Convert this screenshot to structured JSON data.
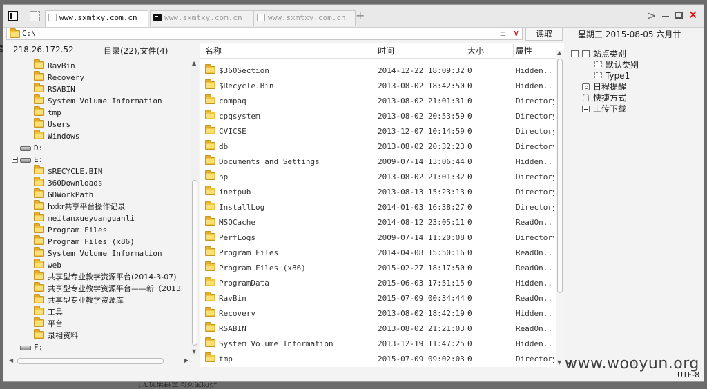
{
  "tabs": [
    {
      "label": "www.sxmtxy.com.cn",
      "icon": "page-icon",
      "active": true
    },
    {
      "label": "www.sxmtxy.com.cn",
      "icon": "terminal-icon",
      "active": false
    },
    {
      "label": "www.sxmtxy.com.cn",
      "icon": "page-icon",
      "active": false
    }
  ],
  "tabbar": {
    "new_tab": "+",
    "chevron": ">",
    "close": "✕"
  },
  "address": {
    "value": "C:\\",
    "plusminus": "±",
    "dropdown": "∨"
  },
  "toolbar": {
    "read_label": "读取",
    "date_text": "星期三  2015-08-05  六月廿一"
  },
  "left": {
    "ip": "218.26.172.52",
    "counts": "目录(22),文件(4)",
    "tree": [
      {
        "label": "RavBin",
        "type": "folder"
      },
      {
        "label": "Recovery",
        "type": "folder"
      },
      {
        "label": "RSABIN",
        "type": "folder"
      },
      {
        "label": "System Volume Information",
        "type": "folder"
      },
      {
        "label": "tmp",
        "type": "folder"
      },
      {
        "label": "Users",
        "type": "folder"
      },
      {
        "label": "Windows",
        "type": "folder"
      },
      {
        "label": "D:",
        "type": "drive"
      },
      {
        "label": "E:",
        "type": "drive"
      },
      {
        "label": "$RECYCLE.BIN",
        "type": "folder"
      },
      {
        "label": "360Downloads",
        "type": "folder"
      },
      {
        "label": "GDWorkPath",
        "type": "folder"
      },
      {
        "label": "hxkr共享平台操作记录",
        "type": "folder"
      },
      {
        "label": "meitanxueyuanguanli",
        "type": "folder"
      },
      {
        "label": "Program Files",
        "type": "folder"
      },
      {
        "label": "Program Files (x86)",
        "type": "folder"
      },
      {
        "label": "System Volume Information",
        "type": "folder"
      },
      {
        "label": "web",
        "type": "folder"
      },
      {
        "label": "共享型专业教学资源平台(2014-3-07)",
        "type": "folder"
      },
      {
        "label": "共享型专业教学资源平台——新（2013",
        "type": "folder"
      },
      {
        "label": "共享型专业教学资源库",
        "type": "folder"
      },
      {
        "label": "工具",
        "type": "folder"
      },
      {
        "label": "平台",
        "type": "folder"
      },
      {
        "label": "录相资料",
        "type": "folder"
      },
      {
        "label": "F:",
        "type": "drive"
      }
    ]
  },
  "filelist": {
    "columns": [
      "名称",
      "时间",
      "大小",
      "属性"
    ],
    "rows": [
      {
        "name": "$360Section",
        "time": "2014-12-22 18:09:32",
        "size": "0",
        "attr": "Hidden..."
      },
      {
        "name": "$Recycle.Bin",
        "time": "2013-08-02 18:42:50",
        "size": "0",
        "attr": "Hidden..."
      },
      {
        "name": "compaq",
        "time": "2013-08-02 21:01:31",
        "size": "0",
        "attr": "Directory"
      },
      {
        "name": "cpqsystem",
        "time": "2013-08-02 20:53:59",
        "size": "0",
        "attr": "Directory"
      },
      {
        "name": "CVICSE",
        "time": "2013-12-07 10:14:59",
        "size": "0",
        "attr": "Directory"
      },
      {
        "name": "db",
        "time": "2013-08-02 20:32:23",
        "size": "0",
        "attr": "Directory"
      },
      {
        "name": "Documents and Settings",
        "time": "2009-07-14 13:06:44",
        "size": "0",
        "attr": "Hidden..."
      },
      {
        "name": "hp",
        "time": "2013-08-02 21:01:32",
        "size": "0",
        "attr": "Directory"
      },
      {
        "name": "inetpub",
        "time": "2013-08-13 15:23:13",
        "size": "0",
        "attr": "Directory"
      },
      {
        "name": "InstallLog",
        "time": "2014-01-03 16:38:27",
        "size": "0",
        "attr": "Directory"
      },
      {
        "name": "MSOCache",
        "time": "2014-08-12 23:05:11",
        "size": "0",
        "attr": "ReadOn..."
      },
      {
        "name": "PerfLogs",
        "time": "2009-07-14 11:20:08",
        "size": "0",
        "attr": "Directory"
      },
      {
        "name": "Program Files",
        "time": "2014-04-08 15:50:16",
        "size": "0",
        "attr": "ReadOn..."
      },
      {
        "name": "Program Files (x86)",
        "time": "2015-02-27 18:17:50",
        "size": "0",
        "attr": "ReadOn..."
      },
      {
        "name": "ProgramData",
        "time": "2015-06-03 17:51:15",
        "size": "0",
        "attr": "Hidden..."
      },
      {
        "name": "RavBin",
        "time": "2015-07-09 00:34:44",
        "size": "0",
        "attr": "ReadOn..."
      },
      {
        "name": "Recovery",
        "time": "2013-08-02 18:42:19",
        "size": "0",
        "attr": "Hidden..."
      },
      {
        "name": "RSABIN",
        "time": "2013-08-02 21:21:03",
        "size": "0",
        "attr": "ReadOn..."
      },
      {
        "name": "System Volume Information",
        "time": "2013-12-19 11:47:25",
        "size": "0",
        "attr": "Hidden..."
      },
      {
        "name": "tmp",
        "time": "2015-07-09 09:02:03",
        "size": "0",
        "attr": "Directory"
      }
    ]
  },
  "right": {
    "items": [
      {
        "label": "站点类别",
        "icon": "collapse-box-icon"
      },
      {
        "label": "默认类别",
        "icon": "category-icon"
      },
      {
        "label": "Type1",
        "icon": "category-icon"
      },
      {
        "label": "日程提醒",
        "icon": "reminder-icon"
      },
      {
        "label": "快捷方式",
        "icon": "shortcut-icon"
      },
      {
        "label": "上传下载",
        "icon": "transfer-icon"
      }
    ]
  },
  "status": {
    "encoding": "UTF-8"
  },
  "watermark": "www.wooyun.org",
  "background": {
    "left_char": "君",
    "bottom_text": "(无忧集群空间安全防护"
  }
}
